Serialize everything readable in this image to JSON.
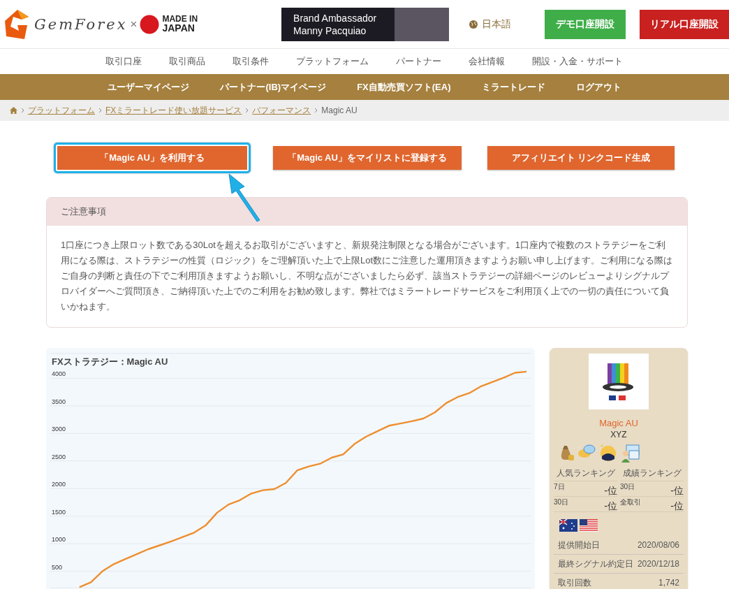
{
  "header": {
    "logo": {
      "brand": "GemForex",
      "times": "×",
      "made_in": "MADE IN",
      "japan": "JAPAN"
    },
    "banner": {
      "line_1": "Brand Ambassador",
      "line_2": "Manny Pacquiao"
    },
    "language": "日本語",
    "buttons": [
      {
        "label": "デモ口座開設",
        "kind": "demo"
      },
      {
        "label": "リアル口座開設",
        "kind": "real"
      }
    ]
  },
  "main_nav": [
    "取引口座",
    "取引商品",
    "取引条件",
    "プラットフォーム",
    "パートナー",
    "会社情報",
    "開設・入金・サポート"
  ],
  "member_nav": [
    "ユーザーマイページ",
    "パートナー(IB)マイページ",
    "FX自動売買ソフト(EA)",
    "ミラートレード",
    "ログアウト"
  ],
  "breadcrumb": {
    "links": [
      "プラットフォーム",
      "FXミラートレード使い放題サービス",
      "パフォーマンス"
    ],
    "current": "Magic AU"
  },
  "actions": [
    {
      "label": "「Magic AU」を利用する",
      "highlighted": true
    },
    {
      "label": "「Magic AU」をマイリストに登録する",
      "highlighted": false
    },
    {
      "label": "アフィリエイト リンクコード生成",
      "highlighted": false
    }
  ],
  "notice": {
    "title": "ご注意事項",
    "body": "1口座につき上限ロット数である30Lotを超えるお取引がございますと、新規発注制限となる場合がございます。1口座内で複数のストラテジーをご利用になる際は、ストラテジーの性質（ロジック）をご理解頂いた上で上限Lot数にご注意した運用頂きますようお願い申し上げます。ご利用になる際はご自身の判断と責任の下でご利用頂きますようお願いし、不明な点がございましたら必ず、該当ストラテジーの詳細ページのレビューよりシグナルプロバイダーへご質問頂き、ご納得頂いた上でのご利用をお勧め致します。弊社ではミラートレードサービスをご利用頂く上での一切の責任について負いかねます。"
  },
  "chart": {
    "chart_data": {
      "type": "line",
      "title": "FXストラテジー：Magic AU",
      "ylim": [
        200,
        4450
      ],
      "grid": true,
      "yticks": [
        500,
        1000,
        1500,
        2000,
        2500,
        3000,
        3500,
        4000
      ],
      "series": [
        {
          "color": "#ee8e2e",
          "values": [
            null,
            null,
            210,
            300,
            500,
            630,
            720,
            810,
            900,
            970,
            1040,
            1120,
            1200,
            1330,
            1560,
            1710,
            1790,
            1910,
            1970,
            1990,
            2100,
            2330,
            2400,
            2450,
            2560,
            2620,
            2810,
            2940,
            3040,
            3140,
            3180,
            3220,
            3270,
            3380,
            3550,
            3660,
            3730,
            3850,
            3930,
            4010,
            4100,
            4120
          ]
        }
      ]
    }
  },
  "strategy_card": {
    "name": "Magic AU",
    "provider": "XYZ",
    "rankings": [
      {
        "title": "人気ランキング",
        "rows": [
          {
            "period": "7日",
            "rank": "-位"
          },
          {
            "period": "30日",
            "rank": "-位"
          }
        ]
      },
      {
        "title": "成績ランキング",
        "rows": [
          {
            "period": "30日",
            "rank": "-位"
          },
          {
            "period": "全取引",
            "rank": "-位"
          }
        ]
      }
    ],
    "details": [
      {
        "label": "提供開始日",
        "value": "2020/08/06"
      },
      {
        "label": "最終シグナル約定日",
        "value": "2020/12/18"
      },
      {
        "label": "取引回数",
        "value": "1,742"
      }
    ]
  }
}
